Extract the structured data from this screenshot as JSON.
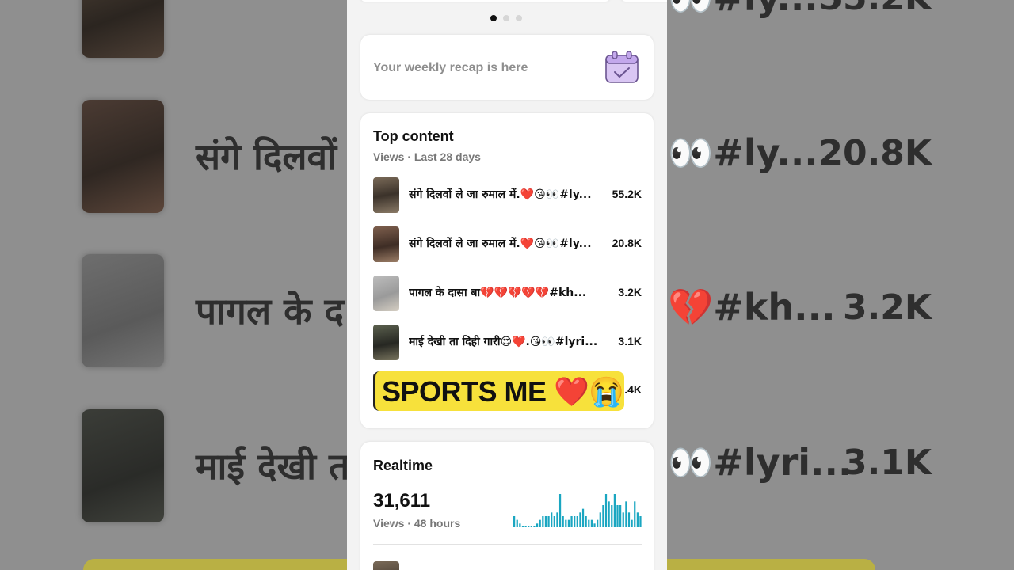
{
  "background": {
    "rows": [
      {
        "title": "संगे दिलवों",
        "title_right": "👀#ly...",
        "value": "20.8K"
      },
      {
        "title": "पागल के द",
        "title_right": "💔#kh...",
        "value": "3.2K"
      },
      {
        "title": "माई देखी त",
        "title_right": "👀#lyri...",
        "value": "3.1K"
      }
    ],
    "top_value": "55.2K",
    "top_title_right": "👀#ly..."
  },
  "carousel": {
    "pages": 3,
    "active": 0
  },
  "recap": {
    "text": "Your weekly recap is here",
    "icon": "calendar-check-icon"
  },
  "top_content": {
    "title": "Top content",
    "subtitle": "Views · Last 28 days",
    "items": [
      {
        "label": "संगे दिलवों ले जा रुमाल में.❤️😘👀#ly...",
        "value": "55.2K"
      },
      {
        "label": "संगे दिलवों ले जा रुमाल में.❤️😘👀#ly...",
        "value": "20.8K"
      },
      {
        "label": "पागल के दासा बा💔💔💔💔💔#kh...",
        "value": "3.2K"
      },
      {
        "label": "माई देखी ता दिही गारी😍❤️.😘👀#lyri...",
        "value": "3.1K"
      },
      {
        "label": "",
        "value": ".4K"
      }
    ]
  },
  "sticker": {
    "text": "SPORTS ME ❤️😭"
  },
  "realtime": {
    "title": "Realtime",
    "count": "31,611",
    "subtitle": "Views · 48 hours",
    "bars": [
      3,
      2,
      1,
      0,
      0,
      0,
      0,
      0,
      1,
      2,
      3,
      3,
      3,
      4,
      3,
      4,
      9,
      3,
      2,
      2,
      3,
      3,
      3,
      4,
      5,
      3,
      2,
      2,
      1,
      2,
      4,
      6,
      9,
      7,
      6,
      9,
      6,
      6,
      4,
      7,
      4,
      2,
      7,
      4,
      3
    ],
    "bar_color": "#1aa6c1"
  },
  "colors": {
    "accent": "#1aa6c1",
    "sticker": "#f7e13b"
  }
}
